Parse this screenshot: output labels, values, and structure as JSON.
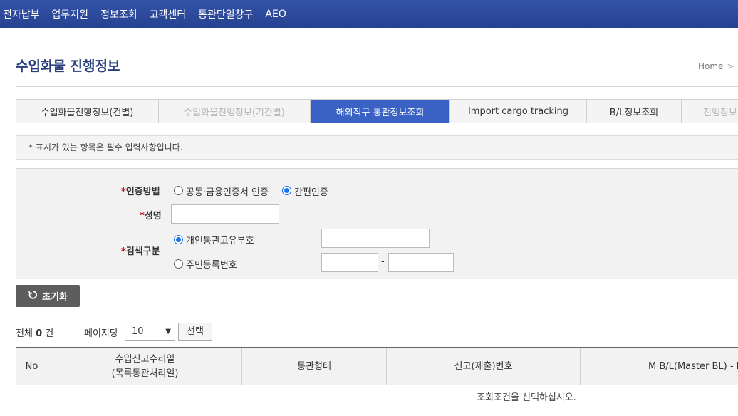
{
  "topnav": {
    "items": [
      "전자납부",
      "업무지원",
      "정보조회",
      "고객센터",
      "통관단일창구",
      "AEO"
    ]
  },
  "page": {
    "title": "수입화물 진행정보",
    "breadcrumb_home": "Home",
    "breadcrumb_sep": ">"
  },
  "tabs": [
    {
      "label": "수입화물진행정보(건별)",
      "state": "normal"
    },
    {
      "label": "수입화물진행정보(기간별)",
      "state": "dim"
    },
    {
      "label": "해외직구 통관정보조회",
      "state": "active"
    },
    {
      "label": "Import cargo tracking",
      "state": "normal"
    },
    {
      "label": "B/L정보조회",
      "state": "normal"
    },
    {
      "label": "진행정보",
      "state": "dim"
    }
  ],
  "notice": "* 표시가 있는 항목은 필수 입력사항입니다.",
  "form": {
    "required_mark": "*",
    "auth_label": "인증방법",
    "auth_options": [
      "공동·금융인증서 인증",
      "간편인증"
    ],
    "auth_selected": "간편인증",
    "name_label": "성명",
    "name_value": "",
    "search_type_label": "검색구분",
    "search_options": [
      "개인통관고유부호",
      "주민등록번호"
    ],
    "search_selected": "개인통관고유부호",
    "code_value": "",
    "rrn_front": "",
    "rrn_back": "",
    "rrn_separator": "-"
  },
  "actions": {
    "reset_label": "초기화"
  },
  "list_controls": {
    "total_prefix": "전체",
    "total_count": "0",
    "total_suffix": "건",
    "per_page_label": "페이지당",
    "per_page_value": "10",
    "select_button": "선택"
  },
  "table": {
    "columns": [
      "No",
      "수입신고수리일",
      "(목록통관처리일)",
      "통관형태",
      "신고(제출)번호",
      "M B/L(Master BL) - H"
    ],
    "empty_message": "조회조건을 선택하십시오."
  },
  "colors": {
    "nav_bg": "#2e4a9e",
    "tab_active": "#3a62c4",
    "title": "#2a3f7e",
    "required": "#d0021b",
    "radio_checked": "#1a73e8",
    "reset_button": "#5d5d5d"
  },
  "icons": {
    "reset": "refresh-icon",
    "select_arrow": "chevron-down-icon"
  }
}
